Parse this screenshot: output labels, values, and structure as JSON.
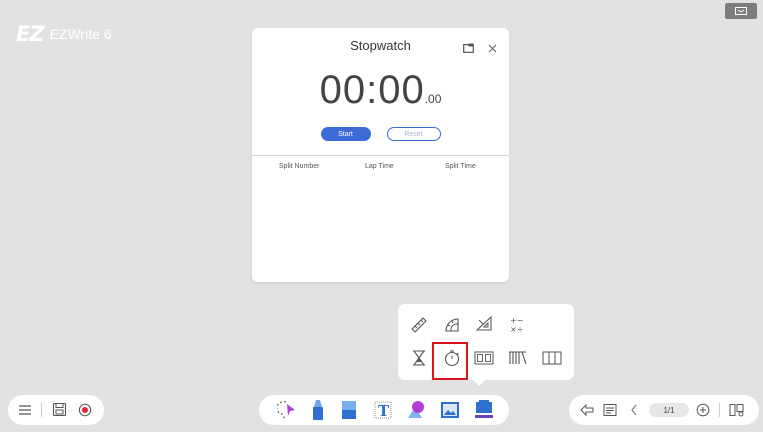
{
  "app": {
    "logo_mark": "EZ",
    "logo_name": "EZWrite 6"
  },
  "stopwatch": {
    "title": "Stopwatch",
    "time_main": "00:00",
    "time_ms": ".00",
    "start_label": "Start",
    "reset_label": "Reset",
    "columns": [
      "Split Number",
      "Lap Time",
      "Split Time"
    ]
  },
  "tools_popup": {
    "row1": [
      "ruler-icon",
      "protractor-icon",
      "set-square-icon",
      "calculator-operators-icon"
    ],
    "row2": [
      "hourglass-icon",
      "stopwatch-icon",
      "scoreboard-icon",
      "curtain-icon",
      "column-layout-icon"
    ],
    "operators_glyph": "+−\n×÷",
    "highlighted_tool": "stopwatch-icon",
    "highlight_color": "#d9141b"
  },
  "toolbar": {
    "left": [
      "menu-icon",
      "save-icon",
      "record-icon"
    ],
    "center": [
      "lasso-select-icon",
      "pen-icon",
      "eraser-icon",
      "text-icon",
      "shapes-icon",
      "image-icon",
      "toolbox-icon"
    ],
    "right": [
      "back-icon",
      "notes-icon",
      "previous-page-icon",
      "next-page-icon",
      "add-page-icon",
      "page-manager-icon"
    ],
    "page_indicator": "1/1"
  },
  "colors": {
    "background": "#e2e2e2",
    "accent": "#3c6ad6",
    "record": "#e0253a"
  }
}
